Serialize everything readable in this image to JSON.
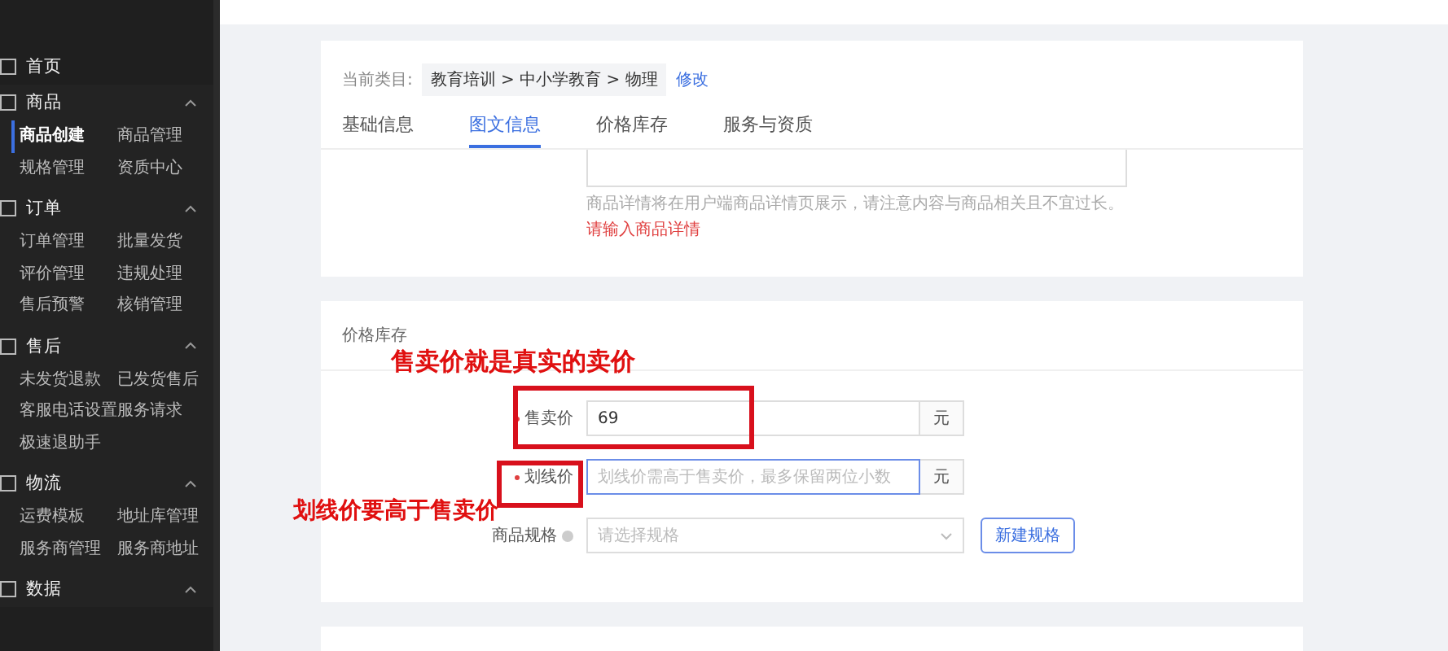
{
  "sidebar": {
    "home": {
      "label": "首页"
    },
    "groups": [
      {
        "title": "商品",
        "expanded": true,
        "items": [
          {
            "label": "商品创建",
            "selected": true
          },
          {
            "label": "商品管理",
            "selected": false
          },
          {
            "label": "规格管理",
            "selected": false
          },
          {
            "label": "资质中心",
            "selected": false
          }
        ]
      },
      {
        "title": "订单",
        "expanded": true,
        "items": [
          {
            "label": "订单管理",
            "selected": false
          },
          {
            "label": "批量发货",
            "selected": false
          },
          {
            "label": "评价管理",
            "selected": false
          },
          {
            "label": "违规处理",
            "selected": false
          },
          {
            "label": "售后预警",
            "selected": false
          },
          {
            "label": "核销管理",
            "selected": false
          }
        ]
      },
      {
        "title": "售后",
        "expanded": true,
        "items": [
          {
            "label": "未发货退款",
            "selected": false
          },
          {
            "label": "已发货售后",
            "selected": false
          },
          {
            "label": "客服电话设置",
            "selected": false
          },
          {
            "label": "服务请求",
            "selected": false
          },
          {
            "label": "极速退助手",
            "selected": false
          }
        ]
      },
      {
        "title": "物流",
        "expanded": true,
        "items": [
          {
            "label": "运费模板",
            "selected": false
          },
          {
            "label": "地址库管理",
            "selected": false
          },
          {
            "label": "服务商管理",
            "selected": false
          },
          {
            "label": "服务商地址",
            "selected": false
          }
        ]
      },
      {
        "title": "数据",
        "expanded": true
      }
    ]
  },
  "category": {
    "label": "当前类目:",
    "path": "教育培训 > 中小学教育 > 物理",
    "link": "修改"
  },
  "tabs": [
    {
      "label": "基础信息",
      "selected": false
    },
    {
      "label": "图文信息",
      "selected": true
    },
    {
      "label": "价格库存",
      "selected": false
    },
    {
      "label": "服务与资质",
      "selected": false
    }
  ],
  "detail": {
    "hint": "商品详情将在用户端商品详情页展示，请注意内容与商品相关且不宜过长。",
    "error": "请输入商品详情"
  },
  "price_section": {
    "title": "价格库存",
    "fields": [
      {
        "kind": "input",
        "label": "售卖价",
        "required": true,
        "value": "69",
        "suffix": "元",
        "focused": false
      },
      {
        "kind": "input",
        "label": "划线价",
        "required": true,
        "placeholder": "划线价需高于售卖价，最多保留两位小数",
        "suffix": "元",
        "focused": true
      },
      {
        "kind": "select",
        "label": "商品规格",
        "required": false,
        "placeholder": "请选择规格",
        "button": "新建规格"
      }
    ]
  },
  "annotations": [
    {
      "kind": "text",
      "text": "售卖价就是真实的卖价"
    },
    {
      "kind": "box"
    },
    {
      "kind": "box"
    },
    {
      "kind": "text",
      "text": "划线价要高于售卖价"
    }
  ]
}
